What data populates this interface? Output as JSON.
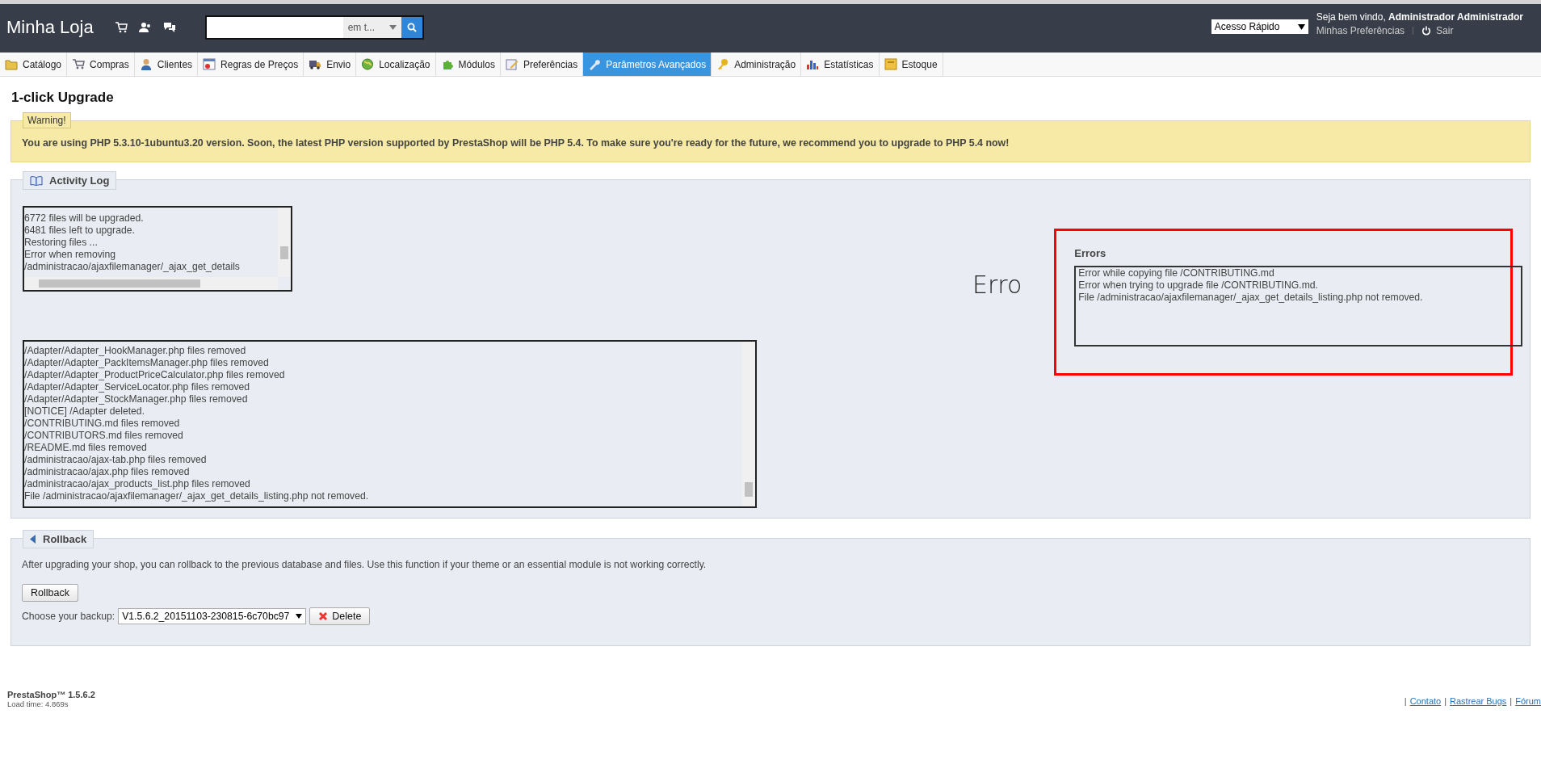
{
  "header": {
    "shop_name": "Minha Loja",
    "search": {
      "scope": "em t..."
    },
    "quick_access": "Acesso Rápido",
    "welcome": "Seja bem vindo, **Administrador Administrador**",
    "preferences_link": "Minhas Preferências",
    "logout": "Sair"
  },
  "tabs": [
    {
      "label": "Catálogo",
      "selected": false
    },
    {
      "label": "Compras",
      "selected": false
    },
    {
      "label": "Clientes",
      "selected": false
    },
    {
      "label": "Regras de Preços",
      "selected": false
    },
    {
      "label": "Envio",
      "selected": false
    },
    {
      "label": "Localização",
      "selected": false
    },
    {
      "label": "Módulos",
      "selected": false
    },
    {
      "label": "Preferências",
      "selected": false
    },
    {
      "label": "Parâmetros Avançados",
      "selected": true
    },
    {
      "label": "Administração",
      "selected": false
    },
    {
      "label": "Estatísticas",
      "selected": false
    },
    {
      "label": "Estoque",
      "selected": false
    }
  ],
  "page_title": "1-click Upgrade",
  "warning": {
    "legend": "Warning!",
    "message": "You are using PHP 5.3.10-1ubuntu3.20 version. Soon, the latest PHP version supported by PrestaShop will be PHP 5.4. To make sure you're ready for the future, we recommend you to upgrade to PHP 5.4 now!"
  },
  "activity_log": {
    "legend": "Activity Log",
    "short_log": [
      "6772 files will be upgraded.",
      "6481 files left to upgrade.",
      "Restoring files ...",
      "Error when removing",
      "/administracao/ajaxfilemanager/_ajax_get_details"
    ],
    "full_log": [
      "/Adapter/Adapter_HookManager.php files removed",
      "/Adapter/Adapter_PackItemsManager.php files removed",
      "/Adapter/Adapter_ProductPriceCalculator.php files removed",
      "/Adapter/Adapter_ServiceLocator.php files removed",
      "/Adapter/Adapter_StockManager.php files removed",
      "[NOTICE] /Adapter deleted.",
      "/CONTRIBUTING.md files removed",
      "/CONTRIBUTORS.md files removed",
      "/README.md files removed",
      "/administracao/ajax-tab.php files removed",
      "/administracao/ajax.php files removed",
      "/administracao/ajax_products_list.php files removed",
      "File /administracao/ajaxfilemanager/_ajax_get_details_listing.php not removed."
    ],
    "annotation": "Erro",
    "errors": {
      "title": "Errors",
      "lines": [
        "Error while copying file /CONTRIBUTING.md",
        "Error when trying to upgrade file /CONTRIBUTING.md.",
        "File /administracao/ajaxfilemanager/_ajax_get_details_listing.php not removed."
      ]
    }
  },
  "rollback": {
    "legend": "Rollback",
    "description": "After upgrading your shop, you can rollback to the previous database and files. Use this function if your theme or an essential module is not working correctly.",
    "button": "Rollback",
    "backup_label": "Choose your backup:",
    "backup_value": "V1.5.6.2_20151103-230815-6c70bc97",
    "delete_button": "Delete"
  },
  "footer": {
    "version": "PrestaShop™ 1.5.6.2",
    "load_time": "Load time: 4.869s",
    "links": [
      {
        "separator": "|",
        "label": "Contato"
      },
      {
        "separator": "|",
        "label": "Rastrear Bugs"
      },
      {
        "separator": "|",
        "label": "Fórum"
      }
    ]
  }
}
